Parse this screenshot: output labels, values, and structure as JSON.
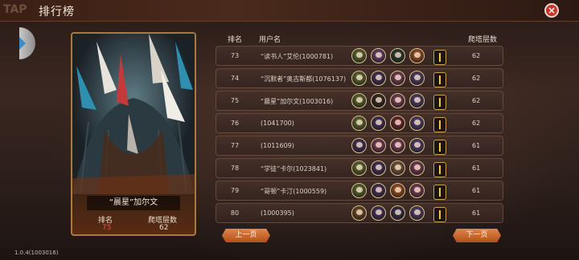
{
  "header": {
    "title": "排行榜",
    "logo_text": "TAP",
    "close_icon": "×"
  },
  "card": {
    "player_name": "“晨星”加尔文",
    "rank_label": "排名",
    "rank_value": "75",
    "floor_label": "爬塔层数",
    "floor_value": "62"
  },
  "table": {
    "columns": {
      "rank": "排名",
      "user": "用户名",
      "floor": "爬塔层数"
    },
    "rows": [
      {
        "rank": "73",
        "user": "“读书人”艾伦(1000781)",
        "floor": "62",
        "avatars": [
          "#6a7d3a",
          "#7a4e86",
          "#2f4a3a",
          "#b5622a"
        ]
      },
      {
        "rank": "74",
        "user": "“沉默者”奥古斯都(1076137)",
        "floor": "62",
        "avatars": [
          "#6a7d3a",
          "#4d3a6e",
          "#8b4b6a",
          "#5b4a7d"
        ]
      },
      {
        "rank": "75",
        "user": "“晨星”加尔文(1003016)",
        "floor": "62",
        "avatars": [
          "#6a7d3a",
          "#3a3028",
          "#8b4b6a",
          "#5b4a7d"
        ]
      },
      {
        "rank": "76",
        "user": "(1041700)",
        "floor": "62",
        "avatars": [
          "#6a7d3a",
          "#4d3a6e",
          "#7a2e3a",
          "#5b4a7d"
        ]
      },
      {
        "rank": "77",
        "user": "(1011609)",
        "floor": "61",
        "avatars": [
          "#4d3a6e",
          "#8b4b6a",
          "#8b4b6a",
          "#5b4a7d"
        ]
      },
      {
        "rank": "78",
        "user": "“学徒”卡尔(1023841)",
        "floor": "61",
        "avatars": [
          "#6a7d3a",
          "#4d3a6e",
          "#8b6a4a",
          "#8b4b6a"
        ]
      },
      {
        "rank": "79",
        "user": "“哥顿”卡汀(1000559)",
        "floor": "61",
        "avatars": [
          "#6a7d3a",
          "#4d3a6e",
          "#b5622a",
          "#8b4b6a"
        ]
      },
      {
        "rank": "80",
        "user": "(1000395)",
        "floor": "61",
        "avatars": [
          "#7a5a2a",
          "#4d3a6e",
          "#3a3a5a",
          "#5b4a7d"
        ]
      }
    ]
  },
  "pagination": {
    "prev": "上一页",
    "next": "下一页"
  },
  "version": "1.0.4(1003016)",
  "colors": {
    "accent_orange": "#d9733a",
    "rank_highlight": "#e2504a",
    "close_red": "#c9332a"
  }
}
